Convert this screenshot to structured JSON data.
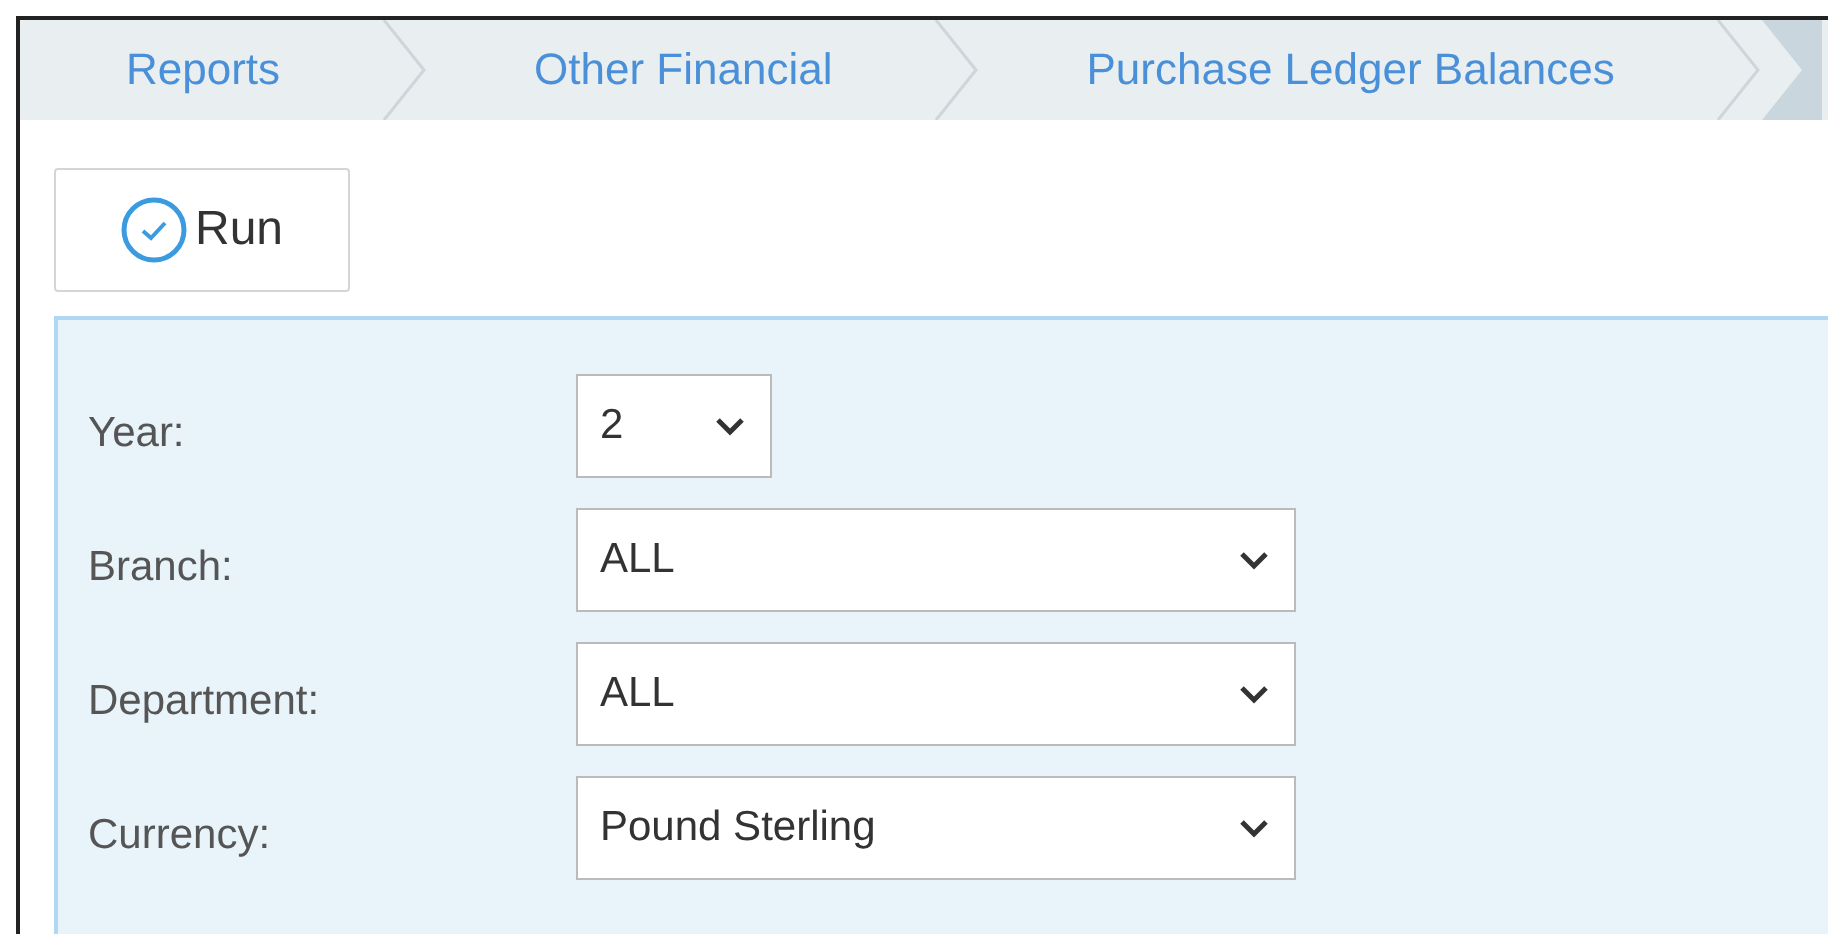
{
  "breadcrumbs": [
    {
      "label": "Reports"
    },
    {
      "label": "Other Financial"
    },
    {
      "label": "Purchase Ledger Balances"
    }
  ],
  "run_button": {
    "label": "Run"
  },
  "fields": [
    {
      "label": "Year:",
      "value": "2",
      "kind": "short"
    },
    {
      "label": "Branch:",
      "value": "ALL",
      "kind": "wide"
    },
    {
      "label": "Department:",
      "value": "ALL",
      "kind": "wide"
    },
    {
      "label": "Currency:",
      "value": "Pound Sterling",
      "kind": "wide"
    }
  ]
}
